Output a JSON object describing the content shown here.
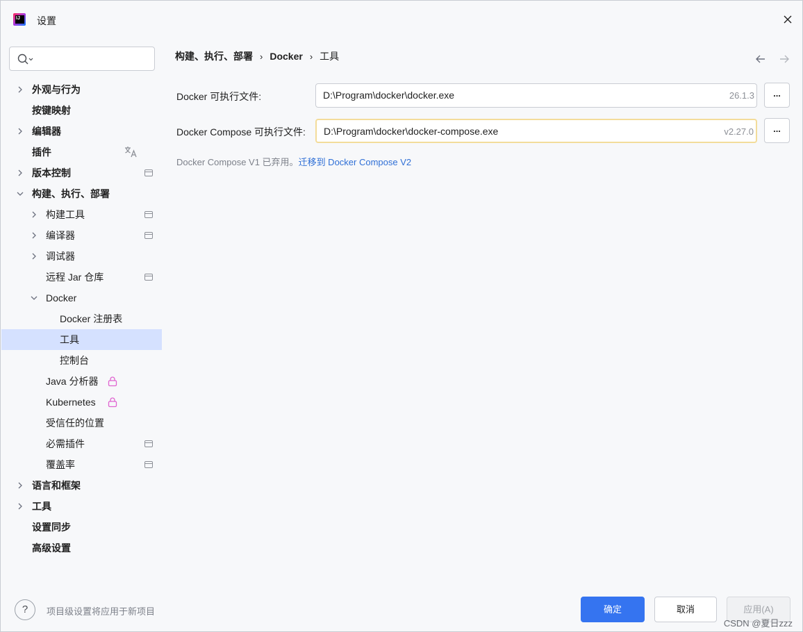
{
  "window": {
    "title": "设置"
  },
  "search": {
    "value": "",
    "placeholder": ""
  },
  "tree": [
    {
      "label": "外观与行为",
      "expandable": true,
      "bold": true
    },
    {
      "label": "按键映射",
      "bold": true
    },
    {
      "label": "编辑器",
      "expandable": true,
      "bold": true
    },
    {
      "label": "插件",
      "bold": true,
      "icon": "translate-icon"
    },
    {
      "label": "版本控制",
      "expandable": true,
      "bold": true,
      "icon": "project-level-icon"
    },
    {
      "label": "构建、执行、部署",
      "expanded": true,
      "bold": true
    },
    {
      "label": "构建工具",
      "expandable": true,
      "icon": "project-level-icon"
    },
    {
      "label": "编译器",
      "expandable": true,
      "icon": "project-level-icon"
    },
    {
      "label": "调试器",
      "expandable": true
    },
    {
      "label": "远程 Jar 仓库",
      "icon": "project-level-icon"
    },
    {
      "label": "Docker",
      "expanded": true
    },
    {
      "label": "Docker 注册表"
    },
    {
      "label": "工具",
      "selected": true
    },
    {
      "label": "控制台"
    },
    {
      "label": "Java 分析器",
      "icon": "lock-icon"
    },
    {
      "label": "Kubernetes",
      "icon": "lock-icon"
    },
    {
      "label": "受信任的位置"
    },
    {
      "label": "必需插件",
      "icon": "project-level-icon"
    },
    {
      "label": "覆盖率",
      "icon": "project-level-icon"
    },
    {
      "label": "语言和框架",
      "expandable": true,
      "bold": true
    },
    {
      "label": "工具",
      "expandable": true,
      "bold": true
    },
    {
      "label": "设置同步",
      "bold": true
    },
    {
      "label": "高级设置",
      "bold": true
    }
  ],
  "breadcrumb": [
    "构建、执行、部署",
    "Docker",
    "工具"
  ],
  "fields": {
    "docker": {
      "label": "Docker 可执行文件:",
      "value": "D:\\Program\\docker\\docker.exe",
      "version": "26.1.3",
      "browse": "..."
    },
    "compose": {
      "label": "Docker Compose 可执行文件:",
      "value": "D:\\Program\\docker\\docker-compose.exe",
      "version": "v2.27.0",
      "browse": "..."
    }
  },
  "hint": {
    "text": "Docker Compose V1 已弃用。",
    "link": "迁移到 Docker Compose V2"
  },
  "footer": {
    "help": "?",
    "note": "项目级设置将应用于新项目",
    "ok": "确定",
    "cancel": "取消",
    "apply": "应用(A)"
  },
  "watermark": "CSDN @夏日zzz",
  "colors": {
    "primary": "#3574f0",
    "selected_row": "#d5e1ff",
    "link": "#2f6fd6",
    "focus_border": "#f3dc9a",
    "lock": "#e063d0"
  }
}
